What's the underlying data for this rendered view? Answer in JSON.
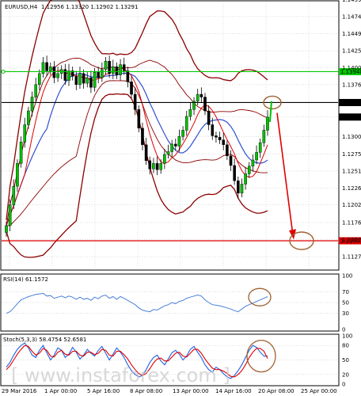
{
  "chart_data": [
    {
      "type": "candlestick",
      "header": {
        "symbol_tf": "EURUSD,H4",
        "ohlc": "1.12956 1.13320 1.12902 1.13291"
      },
      "ylim": [
        1.111,
        1.1495
      ],
      "y_ticks": [
        "1.14990",
        "1.14745",
        "1.14495",
        "1.14250",
        "1.14005",
        "1.13760",
        "1.13501",
        "1.13291",
        "1.13005",
        "1.12755",
        "1.12510",
        "1.12265",
        "1.12020",
        "1.11765",
        "1.11520",
        "1.11270"
      ],
      "y_values": [
        1.1499,
        1.14745,
        1.14495,
        1.1425,
        1.14005,
        1.1376,
        1.13501,
        1.13291,
        1.13005,
        1.12755,
        1.1251,
        1.12265,
        1.1202,
        1.11765,
        1.1152,
        1.1127
      ],
      "x_labels": [
        "29 Mar 2016",
        "1 Apr 00:00",
        "5 Apr 16:00",
        "8 Apr 08:00",
        "13 Apr 00:00",
        "14 Apr 16:00",
        "20 Apr 08:00",
        "25 Apr 00:00"
      ],
      "levels": [
        {
          "label": "1.13948",
          "value": 1.13948,
          "color": "#00c800"
        },
        {
          "label": "1.13501",
          "value": 1.13501,
          "color": "#000000"
        },
        {
          "label": "1.11501",
          "value": 1.11501,
          "color": "#e00000"
        }
      ],
      "last_price": {
        "label": "1.13291",
        "value": 1.13291
      },
      "close_approx": [
        1.1172,
        1.1202,
        1.1229,
        1.1262,
        1.1293,
        1.1318,
        1.1338,
        1.1358,
        1.1376,
        1.1392,
        1.1408,
        1.1396,
        1.1402,
        1.1386,
        1.1392,
        1.1398,
        1.1382,
        1.1396,
        1.1388,
        1.1376,
        1.1392,
        1.1378,
        1.1386,
        1.1372,
        1.1394,
        1.1386,
        1.1398,
        1.141,
        1.1392,
        1.1402,
        1.139,
        1.1405,
        1.1396,
        1.138,
        1.1362,
        1.134,
        1.1313,
        1.1289,
        1.1266,
        1.1254,
        1.1262,
        1.1253,
        1.1262,
        1.1275,
        1.1279,
        1.129,
        1.1287,
        1.1301,
        1.131,
        1.133,
        1.134,
        1.1352,
        1.1362,
        1.1358,
        1.1338,
        1.1318,
        1.1302,
        1.13,
        1.1296,
        1.1289,
        1.1273,
        1.1259,
        1.1237,
        1.1219,
        1.1232,
        1.1247,
        1.1258,
        1.1267,
        1.1278,
        1.1292,
        1.131,
        1.1329
      ],
      "annotations": [
        "down-arrow-target-1.11501",
        "circle-at-1.13501"
      ]
    },
    {
      "type": "line",
      "label": "RSI(14) 61.1572",
      "ylim": [
        0,
        100
      ],
      "y_ticks": [
        "100",
        "70",
        "50",
        "30",
        "0"
      ],
      "values": [
        30,
        33,
        40,
        48,
        55,
        58,
        61,
        63,
        65,
        66,
        67,
        62,
        63,
        58,
        60,
        62,
        59,
        62,
        60,
        56,
        60,
        56,
        58,
        54,
        60,
        57,
        62,
        64,
        58,
        61,
        56,
        61,
        58,
        54,
        50,
        46,
        40,
        36,
        34,
        33,
        37,
        36,
        40,
        44,
        46,
        50,
        48,
        52,
        54,
        58,
        60,
        62,
        64,
        62,
        55,
        50,
        46,
        45,
        44,
        42,
        40,
        38,
        35,
        33,
        38,
        43,
        46,
        49,
        52,
        55,
        58,
        61
      ]
    },
    {
      "type": "line",
      "label": "Stoch(5,3,3) 58.4754 52.6581",
      "ylim": [
        0,
        100
      ],
      "y_ticks": [
        "100",
        "80",
        "50",
        "20",
        "0"
      ],
      "series": [
        {
          "color": "#2060e0",
          "values": [
            35,
            45,
            60,
            72,
            80,
            85,
            75,
            60,
            55,
            70,
            80,
            65,
            50,
            60,
            75,
            70,
            55,
            62,
            76,
            66,
            52,
            60,
            72,
            64,
            58,
            70,
            78,
            64,
            50,
            62,
            75,
            66,
            55,
            40,
            28,
            20,
            15,
            18,
            30,
            45,
            55,
            60,
            48,
            40,
            52,
            65,
            70,
            62,
            50,
            58,
            72,
            78,
            66,
            55,
            40,
            30,
            25,
            35,
            30,
            22,
            15,
            12,
            18,
            28,
            40,
            55,
            70,
            80,
            76,
            66,
            58,
            58
          ]
        },
        {
          "color": "#e00000",
          "values": [
            30,
            38,
            50,
            62,
            72,
            80,
            78,
            68,
            60,
            64,
            74,
            70,
            58,
            56,
            66,
            70,
            62,
            60,
            68,
            68,
            60,
            58,
            66,
            66,
            61,
            64,
            72,
            70,
            60,
            58,
            68,
            68,
            61,
            52,
            40,
            30,
            22,
            18,
            22,
            32,
            44,
            52,
            54,
            48,
            48,
            56,
            64,
            66,
            58,
            56,
            64,
            72,
            72,
            64,
            52,
            42,
            33,
            30,
            30,
            27,
            22,
            16,
            15,
            20,
            28,
            40,
            55,
            66,
            74,
            74,
            68,
            53
          ]
        }
      ]
    }
  ],
  "watermark": "[ www.instaforex.com ]"
}
